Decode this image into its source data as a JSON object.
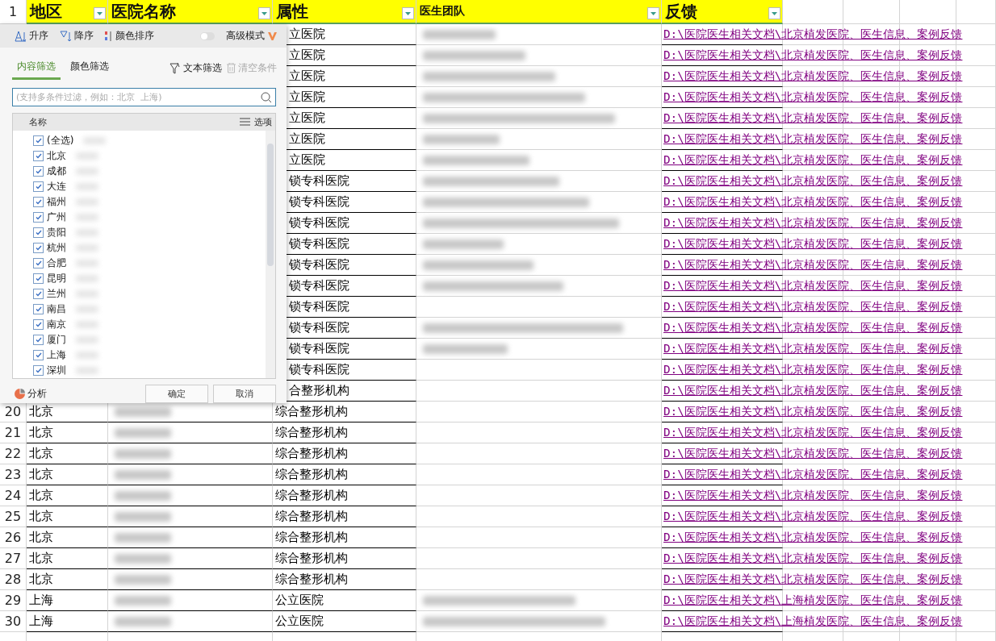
{
  "sheet": {
    "header_row_number": "1",
    "columns": [
      {
        "label": "地区",
        "large": true
      },
      {
        "label": "医院名称",
        "large": true
      },
      {
        "label": "属性",
        "large": true
      },
      {
        "label": "医生团队",
        "large": false
      },
      {
        "label": "反馈",
        "large": true
      }
    ],
    "rows": [
      {
        "attr": "立医院",
        "team_redacted": true,
        "link": "D:\\医院医生相关文档\\北京植发医院、医生信息、案例反馈"
      },
      {
        "attr": "立医院",
        "team_redacted": true,
        "link": "D:\\医院医生相关文档\\北京植发医院、医生信息、案例反馈"
      },
      {
        "attr": "立医院",
        "team_redacted": true,
        "link": "D:\\医院医生相关文档\\北京植发医院、医生信息、案例反馈"
      },
      {
        "attr": "立医院",
        "team_redacted": true,
        "link": "D:\\医院医生相关文档\\北京植发医院、医生信息、案例反馈"
      },
      {
        "attr": "立医院",
        "team_redacted": true,
        "link": "D:\\医院医生相关文档\\北京植发医院、医生信息、案例反馈"
      },
      {
        "attr": "立医院",
        "team_redacted": true,
        "link": "D:\\医院医生相关文档\\北京植发医院、医生信息、案例反馈"
      },
      {
        "attr": "立医院",
        "team_redacted": true,
        "link": "D:\\医院医生相关文档\\北京植发医院、医生信息、案例反馈"
      },
      {
        "attr": "锁专科医院",
        "team_redacted": true,
        "link": "D:\\医院医生相关文档\\北京植发医院、医生信息、案例反馈"
      },
      {
        "attr": "锁专科医院",
        "team_redacted": true,
        "link": "D:\\医院医生相关文档\\北京植发医院、医生信息、案例反馈"
      },
      {
        "attr": "锁专科医院",
        "team_redacted": true,
        "link": "D:\\医院医生相关文档\\北京植发医院、医生信息、案例反馈"
      },
      {
        "attr": "锁专科医院",
        "team_redacted": true,
        "link": "D:\\医院医生相关文档\\北京植发医院、医生信息、案例反馈"
      },
      {
        "attr": "锁专科医院",
        "team_redacted": true,
        "link": "D:\\医院医生相关文档\\北京植发医院、医生信息、案例反馈"
      },
      {
        "attr": "锁专科医院",
        "team_redacted": true,
        "link": "D:\\医院医生相关文档\\北京植发医院、医生信息、案例反馈"
      },
      {
        "attr": "锁专科医院",
        "team_redacted": false,
        "link": "D:\\医院医生相关文档\\北京植发医院、医生信息、案例反馈"
      },
      {
        "attr": "锁专科医院",
        "team_redacted": true,
        "link": "D:\\医院医生相关文档\\北京植发医院、医生信息、案例反馈"
      },
      {
        "attr": "锁专科医院",
        "team_redacted": true,
        "link": "D:\\医院医生相关文档\\北京植发医院、医生信息、案例反馈"
      },
      {
        "attr": "锁专科医院",
        "team_redacted": false,
        "link": "D:\\医院医生相关文档\\北京植发医院、医生信息、案例反馈"
      },
      {
        "attr": "合整形机构",
        "team_redacted": false,
        "link": "D:\\医院医生相关文档\\北京植发医院、医生信息、案例反馈"
      },
      {
        "number": "20",
        "region": "北京",
        "name_redacted": true,
        "attr": "综合整形机构",
        "team_redacted": false,
        "link": "D:\\医院医生相关文档\\北京植发医院、医生信息、案例反馈"
      },
      {
        "number": "21",
        "region": "北京",
        "name_redacted": true,
        "attr": "综合整形机构",
        "team_redacted": false,
        "link": "D:\\医院医生相关文档\\北京植发医院、医生信息、案例反馈"
      },
      {
        "number": "22",
        "region": "北京",
        "name_redacted": true,
        "attr": "综合整形机构",
        "team_redacted": false,
        "link": "D:\\医院医生相关文档\\北京植发医院、医生信息、案例反馈"
      },
      {
        "number": "23",
        "region": "北京",
        "name_redacted": true,
        "attr": "综合整形机构",
        "team_redacted": false,
        "link": "D:\\医院医生相关文档\\北京植发医院、医生信息、案例反馈"
      },
      {
        "number": "24",
        "region": "北京",
        "name_redacted": true,
        "attr": "综合整形机构",
        "team_redacted": false,
        "link": "D:\\医院医生相关文档\\北京植发医院、医生信息、案例反馈"
      },
      {
        "number": "25",
        "region": "北京",
        "name_redacted": true,
        "attr": "综合整形机构",
        "team_redacted": false,
        "link": "D:\\医院医生相关文档\\北京植发医院、医生信息、案例反馈"
      },
      {
        "number": "26",
        "region": "北京",
        "name_redacted": true,
        "attr": "综合整形机构",
        "team_redacted": false,
        "link": "D:\\医院医生相关文档\\北京植发医院、医生信息、案例反馈"
      },
      {
        "number": "27",
        "region": "北京",
        "name_redacted": true,
        "attr": "综合整形机构",
        "team_redacted": false,
        "link": "D:\\医院医生相关文档\\北京植发医院、医生信息、案例反馈"
      },
      {
        "number": "28",
        "region": "北京",
        "name_redacted": true,
        "attr": "综合整形机构",
        "team_redacted": false,
        "link": "D:\\医院医生相关文档\\北京植发医院、医生信息、案例反馈"
      },
      {
        "number": "29",
        "region": "上海",
        "name_redacted": true,
        "attr": "公立医院",
        "team_redacted": true,
        "link": "D:\\医院医生相关文档\\上海植发医院、医生信息、案例反馈"
      },
      {
        "number": "30",
        "region": "上海",
        "name_redacted": true,
        "attr": "公立医院",
        "team_redacted": true,
        "link": "D:\\医院医生相关文档\\上海植发医院、医生信息、案例反馈"
      }
    ]
  },
  "filter_popup": {
    "sort_buttons": [
      "升序",
      "降序",
      "颜色排序"
    ],
    "advanced_mode": {
      "label": "高级模式",
      "on": false
    },
    "tabs": [
      {
        "label": "内容筛选",
        "selected": true
      },
      {
        "label": "颜色筛选",
        "selected": false
      }
    ],
    "text_filter": "文本筛选",
    "clear_conditions": {
      "label": "清空条件",
      "disabled": true
    },
    "search": {
      "placeholder": "(支持多条件过滤，例如：北京  上海)"
    },
    "list_header": "名称",
    "options_button": "选项",
    "items": [
      {
        "label": "(全选)",
        "checked": true
      },
      {
        "label": "北京",
        "checked": true
      },
      {
        "label": "成都",
        "checked": true
      },
      {
        "label": "大连",
        "checked": true
      },
      {
        "label": "福州",
        "checked": true
      },
      {
        "label": "广州",
        "checked": true
      },
      {
        "label": "贵阳",
        "checked": true
      },
      {
        "label": "杭州",
        "checked": true
      },
      {
        "label": "合肥",
        "checked": true
      },
      {
        "label": "昆明",
        "checked": true
      },
      {
        "label": "兰州",
        "checked": true
      },
      {
        "label": "南昌",
        "checked": true
      },
      {
        "label": "南京",
        "checked": true
      },
      {
        "label": "厦门",
        "checked": true
      },
      {
        "label": "上海",
        "checked": true
      },
      {
        "label": "深圳",
        "checked": true
      }
    ],
    "analyze": "分析",
    "buttons": [
      "确定",
      "取消"
    ]
  }
}
